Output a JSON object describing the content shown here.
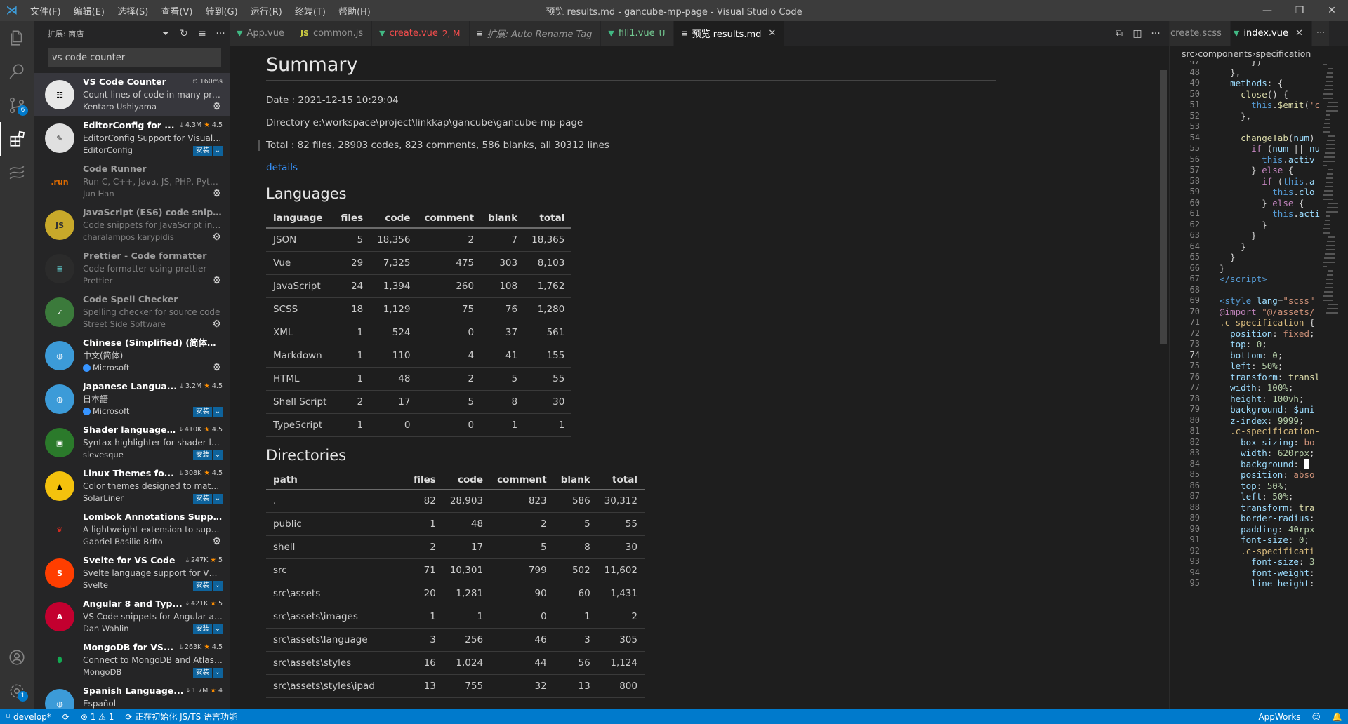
{
  "titlebar": {
    "title": "预览 results.md - gancube-mp-page - Visual Studio Code",
    "menu": [
      "文件(F)",
      "编辑(E)",
      "选择(S)",
      "查看(V)",
      "转到(G)",
      "运行(R)",
      "终端(T)",
      "帮助(H)"
    ]
  },
  "activity": {
    "scm_badge": "6",
    "settings_badge": "1"
  },
  "sidebar": {
    "title": "扩展: 商店",
    "search_value": "vs code counter",
    "install_label": "安装",
    "extensions": [
      {
        "name": "VS Code Counter",
        "stat": "160ms",
        "desc": "Count lines of code in many pro...",
        "publisher": "Kentaro Ushiyama",
        "icon": "counter-icon",
        "installed": true
      },
      {
        "name": "EditorConfig for ...",
        "stat": "4.3M",
        "rating": "4.5",
        "desc": "EditorConfig Support for Visual ...",
        "publisher": "EditorConfig",
        "icon": "editorconfig-icon",
        "installed": false
      },
      {
        "name": "Code Runner",
        "desc": "Run C, C++, Java, JS, PHP, Pytho...",
        "publisher": "Jun Han",
        "icon": "run-icon",
        "installed": true,
        "dim": true
      },
      {
        "name": "JavaScript (ES6) code snippets",
        "desc": "Code snippets for JavaScript in E...",
        "publisher": "charalampos karypidis",
        "icon": "js-icon",
        "installed": true,
        "dim": true
      },
      {
        "name": "Prettier - Code formatter",
        "desc": "Code formatter using prettier",
        "publisher": "Prettier",
        "icon": "prettier-icon",
        "installed": true,
        "dim": true
      },
      {
        "name": "Code Spell Checker",
        "desc": "Spelling checker for source code",
        "publisher": "Street Side Software",
        "icon": "spell-icon",
        "installed": true,
        "dim": true
      },
      {
        "name": "Chinese (Simplified) (简体中文...",
        "desc": "中文(简体)",
        "publisher": "Microsoft",
        "verified": true,
        "icon": "globe-icon",
        "installed": true
      },
      {
        "name": "Japanese Langua...",
        "stat": "3.2M",
        "rating": "4.5",
        "desc": "日本語",
        "publisher": "Microsoft",
        "verified": true,
        "icon": "globe-icon",
        "installed": false
      },
      {
        "name": "Shader language...",
        "stat": "410K",
        "rating": "4.5",
        "desc": "Syntax highlighter for shader lan...",
        "publisher": "slevesque",
        "icon": "shader-icon",
        "installed": false
      },
      {
        "name": "Linux Themes fo...",
        "stat": "308K",
        "rating": "4.5",
        "desc": "Color themes designed to matc...",
        "publisher": "SolarLiner",
        "icon": "linux-icon",
        "installed": false
      },
      {
        "name": "Lombok Annotations Support...",
        "desc": "A lightweight extension to supp...",
        "publisher": "Gabriel Basilio Brito",
        "icon": "pepper-icon",
        "installed": true
      },
      {
        "name": "Svelte for VS Code",
        "stat": "247K",
        "rating": "5",
        "desc": "Svelte language support for VS ...",
        "publisher": "Svelte",
        "icon": "svelte-icon",
        "installed": false
      },
      {
        "name": "Angular 8 and Typ...",
        "stat": "421K",
        "rating": "5",
        "desc": "VS Code snippets for Angular an...",
        "publisher": "Dan Wahlin",
        "icon": "angular-icon",
        "installed": false
      },
      {
        "name": "MongoDB for VS...",
        "stat": "263K",
        "rating": "4.5",
        "desc": "Connect to MongoDB and Atlas ...",
        "publisher": "MongoDB",
        "icon": "mongodb-icon",
        "installed": false
      },
      {
        "name": "Spanish Language...",
        "stat": "1.7M",
        "rating": "4",
        "desc": "Español",
        "publisher": "",
        "icon": "globe-icon",
        "installed": false
      }
    ]
  },
  "editor1": {
    "tabs": [
      {
        "icon": "vue-icon",
        "label": "App.vue",
        "status": ""
      },
      {
        "icon": "js-file-icon",
        "label": "common.js",
        "status": ""
      },
      {
        "icon": "vue-icon",
        "label": "create.vue",
        "status": "2, M"
      },
      {
        "icon": "preview-icon",
        "label": "扩展: Auto Rename Tag",
        "status": ""
      },
      {
        "icon": "vue-icon",
        "label": "fill1.vue",
        "status": "U"
      },
      {
        "icon": "preview-icon",
        "label": "预览 results.md",
        "status": ""
      }
    ],
    "summary": {
      "heading": "Summary",
      "date": "Date : 2021-12-15 10:29:04",
      "directory": "Directory e:\\workspace\\project\\linkkap\\gancube\\gancube-mp-page",
      "total": "Total : 82 files, 28903 codes, 823 comments, 586 blanks, all 30312 lines",
      "details": "details"
    },
    "languages": {
      "heading": "Languages",
      "columns": [
        "language",
        "files",
        "code",
        "comment",
        "blank",
        "total"
      ],
      "rows": [
        [
          "JSON",
          "5",
          "18,356",
          "2",
          "7",
          "18,365"
        ],
        [
          "Vue",
          "29",
          "7,325",
          "475",
          "303",
          "8,103"
        ],
        [
          "JavaScript",
          "24",
          "1,394",
          "260",
          "108",
          "1,762"
        ],
        [
          "SCSS",
          "18",
          "1,129",
          "75",
          "76",
          "1,280"
        ],
        [
          "XML",
          "1",
          "524",
          "0",
          "37",
          "561"
        ],
        [
          "Markdown",
          "1",
          "110",
          "4",
          "41",
          "155"
        ],
        [
          "HTML",
          "1",
          "48",
          "2",
          "5",
          "55"
        ],
        [
          "Shell Script",
          "2",
          "17",
          "5",
          "8",
          "30"
        ],
        [
          "TypeScript",
          "1",
          "0",
          "0",
          "1",
          "1"
        ]
      ]
    },
    "directories": {
      "heading": "Directories",
      "columns": [
        "path",
        "files",
        "code",
        "comment",
        "blank",
        "total"
      ],
      "rows": [
        [
          ".",
          "82",
          "28,903",
          "823",
          "586",
          "30,312"
        ],
        [
          "public",
          "1",
          "48",
          "2",
          "5",
          "55"
        ],
        [
          "shell",
          "2",
          "17",
          "5",
          "8",
          "30"
        ],
        [
          "src",
          "71",
          "10,301",
          "799",
          "502",
          "11,602"
        ],
        [
          "src\\assets",
          "20",
          "1,281",
          "90",
          "60",
          "1,431"
        ],
        [
          "src\\assets\\images",
          "1",
          "1",
          "0",
          "1",
          "2"
        ],
        [
          "src\\assets\\language",
          "3",
          "256",
          "46",
          "3",
          "305"
        ],
        [
          "src\\assets\\styles",
          "16",
          "1,024",
          "44",
          "56",
          "1,124"
        ],
        [
          "src\\assets\\styles\\ipad",
          "13",
          "755",
          "32",
          "13",
          "800"
        ]
      ]
    }
  },
  "editor2": {
    "tabs": [
      {
        "label": "create.scss",
        "icon": ""
      },
      {
        "label": "index.vue",
        "icon": "vue-icon"
      }
    ],
    "breadcrumb": [
      "src",
      "components",
      "specification"
    ],
    "current_line": "74",
    "lines": [
      {
        "n": "47",
        "html": "      })"
      },
      {
        "n": "48",
        "html": "  },"
      },
      {
        "n": "49",
        "html": "  <span class='pr'>methods</span>: {"
      },
      {
        "n": "50",
        "html": "    <span class='fn'>close</span>() {"
      },
      {
        "n": "51",
        "html": "      <span class='tg'>this</span>.<span class='fn'>$emit</span>(<span class='st'>'c</span>"
      },
      {
        "n": "52",
        "html": "    },"
      },
      {
        "n": "53",
        "html": ""
      },
      {
        "n": "54",
        "html": "    <span class='fn'>changeTab</span>(<span class='pr'>num</span>)"
      },
      {
        "n": "55",
        "html": "      <span class='kw'>if</span> (<span class='pr'>num</span> || <span class='pr'>nu</span>"
      },
      {
        "n": "56",
        "html": "        <span class='tg'>this</span>.<span class='pr'>activ</span>"
      },
      {
        "n": "57",
        "html": "      } <span class='kw'>else</span> {"
      },
      {
        "n": "58",
        "html": "        <span class='kw'>if</span> (<span class='tg'>this</span>.<span class='pr'>a</span>"
      },
      {
        "n": "59",
        "html": "          <span class='tg'>this</span>.<span class='pr'>clo</span>"
      },
      {
        "n": "60",
        "html": "        } <span class='kw'>else</span> {"
      },
      {
        "n": "61",
        "html": "          <span class='tg'>this</span>.<span class='pr'>acti</span>"
      },
      {
        "n": "62",
        "html": "        }"
      },
      {
        "n": "63",
        "html": "      }"
      },
      {
        "n": "64",
        "html": "    }"
      },
      {
        "n": "65",
        "html": "  }"
      },
      {
        "n": "66",
        "html": "}"
      },
      {
        "n": "67",
        "html": "<span class='tg'>&lt;/script&gt;</span>"
      },
      {
        "n": "68",
        "html": ""
      },
      {
        "n": "69",
        "html": "<span class='tg'>&lt;style</span> <span class='pr'>lang</span>=<span class='st'>\"scss\"</span>"
      },
      {
        "n": "70",
        "html": "<span class='kw'>@import</span> <span class='st'>\"@/assets/</span>"
      },
      {
        "n": "71",
        "html": "<span class='sl'>.c-specification</span> {"
      },
      {
        "n": "72",
        "html": "  <span class='pr'>position</span>: <span class='st'>fixed</span>;"
      },
      {
        "n": "73",
        "html": "  <span class='pr'>top</span>: <span class='nm'>0</span>;"
      },
      {
        "n": "74",
        "html": "  <span class='pr'>bottom</span>: <span class='nm'>0</span>;"
      },
      {
        "n": "75",
        "html": "  <span class='pr'>left</span>: <span class='nm'>50%</span>;"
      },
      {
        "n": "76",
        "html": "  <span class='pr'>transform</span>: <span class='fn'>transl</span>"
      },
      {
        "n": "77",
        "html": "  <span class='pr'>width</span>: <span class='nm'>100%</span>;"
      },
      {
        "n": "78",
        "html": "  <span class='pr'>height</span>: <span class='nm'>100vh</span>;"
      },
      {
        "n": "79",
        "html": "  <span class='pr'>background</span>: <span class='pr'>$uni-</span>"
      },
      {
        "n": "80",
        "html": "  <span class='pr'>z-index</span>: <span class='nm'>9999</span>;"
      },
      {
        "n": "81",
        "html": "  <span class='sl'>.c-specification-</span>"
      },
      {
        "n": "82",
        "html": "    <span class='pr'>box-sizing</span>: <span class='st'>bo</span>"
      },
      {
        "n": "83",
        "html": "    <span class='pr'>width</span>: <span class='nm'>620rpx</span>;"
      },
      {
        "n": "84",
        "html": "    <span class='pr'>background</span>: <span style='background:#fff;color:#fff'>▪</span>"
      },
      {
        "n": "85",
        "html": "    <span class='pr'>position</span>: <span class='st'>abso</span>"
      },
      {
        "n": "86",
        "html": "    <span class='pr'>top</span>: <span class='nm'>50%</span>;"
      },
      {
        "n": "87",
        "html": "    <span class='pr'>left</span>: <span class='nm'>50%</span>;"
      },
      {
        "n": "88",
        "html": "    <span class='pr'>transform</span>: <span class='fn'>tra</span>"
      },
      {
        "n": "89",
        "html": "    <span class='pr'>border-radius</span>:"
      },
      {
        "n": "90",
        "html": "    <span class='pr'>padding</span>: <span class='nm'>40rpx</span>"
      },
      {
        "n": "91",
        "html": "    <span class='pr'>font-size</span>: <span class='nm'>0</span>;"
      },
      {
        "n": "92",
        "html": "    <span class='sl'>.c-specificati</span>"
      },
      {
        "n": "93",
        "html": "      <span class='pr'>font-size</span>: <span class='nm'>3</span>"
      },
      {
        "n": "94",
        "html": "      <span class='pr'>font-weight</span>:"
      },
      {
        "n": "95",
        "html": "      <span class='pr'>line-height</span>:"
      }
    ]
  },
  "statusbar": {
    "branch": "develop*",
    "problems": "⊗ 1 ⚠ 1",
    "task": "正在初始化 JS/TS 语言功能",
    "right": "AppWorks"
  }
}
